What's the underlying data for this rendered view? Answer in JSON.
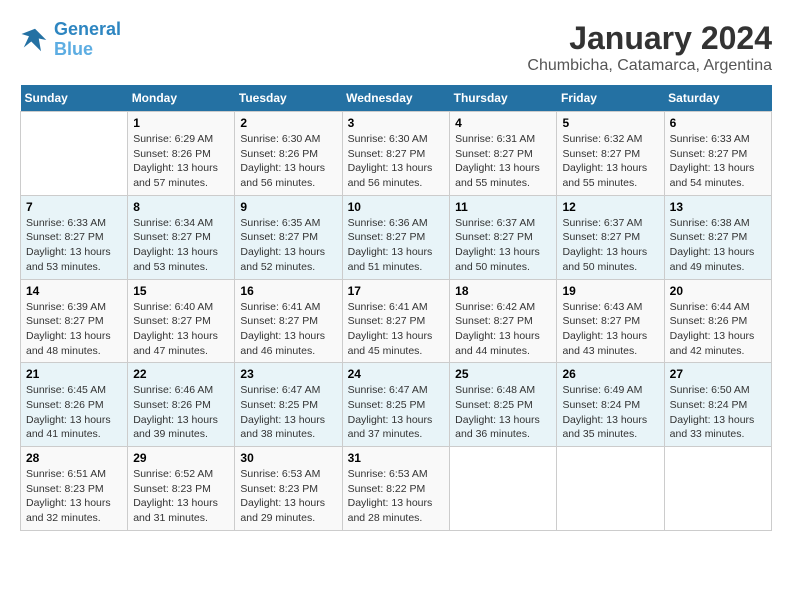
{
  "logo": {
    "line1": "General",
    "line2": "Blue"
  },
  "title": "January 2024",
  "subtitle": "Chumbicha, Catamarca, Argentina",
  "days_header": [
    "Sunday",
    "Monday",
    "Tuesday",
    "Wednesday",
    "Thursday",
    "Friday",
    "Saturday"
  ],
  "weeks": [
    [
      {
        "num": "",
        "sunrise": "",
        "sunset": "",
        "daylight": ""
      },
      {
        "num": "1",
        "sunrise": "Sunrise: 6:29 AM",
        "sunset": "Sunset: 8:26 PM",
        "daylight": "Daylight: 13 hours and 57 minutes."
      },
      {
        "num": "2",
        "sunrise": "Sunrise: 6:30 AM",
        "sunset": "Sunset: 8:26 PM",
        "daylight": "Daylight: 13 hours and 56 minutes."
      },
      {
        "num": "3",
        "sunrise": "Sunrise: 6:30 AM",
        "sunset": "Sunset: 8:27 PM",
        "daylight": "Daylight: 13 hours and 56 minutes."
      },
      {
        "num": "4",
        "sunrise": "Sunrise: 6:31 AM",
        "sunset": "Sunset: 8:27 PM",
        "daylight": "Daylight: 13 hours and 55 minutes."
      },
      {
        "num": "5",
        "sunrise": "Sunrise: 6:32 AM",
        "sunset": "Sunset: 8:27 PM",
        "daylight": "Daylight: 13 hours and 55 minutes."
      },
      {
        "num": "6",
        "sunrise": "Sunrise: 6:33 AM",
        "sunset": "Sunset: 8:27 PM",
        "daylight": "Daylight: 13 hours and 54 minutes."
      }
    ],
    [
      {
        "num": "7",
        "sunrise": "Sunrise: 6:33 AM",
        "sunset": "Sunset: 8:27 PM",
        "daylight": "Daylight: 13 hours and 53 minutes."
      },
      {
        "num": "8",
        "sunrise": "Sunrise: 6:34 AM",
        "sunset": "Sunset: 8:27 PM",
        "daylight": "Daylight: 13 hours and 53 minutes."
      },
      {
        "num": "9",
        "sunrise": "Sunrise: 6:35 AM",
        "sunset": "Sunset: 8:27 PM",
        "daylight": "Daylight: 13 hours and 52 minutes."
      },
      {
        "num": "10",
        "sunrise": "Sunrise: 6:36 AM",
        "sunset": "Sunset: 8:27 PM",
        "daylight": "Daylight: 13 hours and 51 minutes."
      },
      {
        "num": "11",
        "sunrise": "Sunrise: 6:37 AM",
        "sunset": "Sunset: 8:27 PM",
        "daylight": "Daylight: 13 hours and 50 minutes."
      },
      {
        "num": "12",
        "sunrise": "Sunrise: 6:37 AM",
        "sunset": "Sunset: 8:27 PM",
        "daylight": "Daylight: 13 hours and 50 minutes."
      },
      {
        "num": "13",
        "sunrise": "Sunrise: 6:38 AM",
        "sunset": "Sunset: 8:27 PM",
        "daylight": "Daylight: 13 hours and 49 minutes."
      }
    ],
    [
      {
        "num": "14",
        "sunrise": "Sunrise: 6:39 AM",
        "sunset": "Sunset: 8:27 PM",
        "daylight": "Daylight: 13 hours and 48 minutes."
      },
      {
        "num": "15",
        "sunrise": "Sunrise: 6:40 AM",
        "sunset": "Sunset: 8:27 PM",
        "daylight": "Daylight: 13 hours and 47 minutes."
      },
      {
        "num": "16",
        "sunrise": "Sunrise: 6:41 AM",
        "sunset": "Sunset: 8:27 PM",
        "daylight": "Daylight: 13 hours and 46 minutes."
      },
      {
        "num": "17",
        "sunrise": "Sunrise: 6:41 AM",
        "sunset": "Sunset: 8:27 PM",
        "daylight": "Daylight: 13 hours and 45 minutes."
      },
      {
        "num": "18",
        "sunrise": "Sunrise: 6:42 AM",
        "sunset": "Sunset: 8:27 PM",
        "daylight": "Daylight: 13 hours and 44 minutes."
      },
      {
        "num": "19",
        "sunrise": "Sunrise: 6:43 AM",
        "sunset": "Sunset: 8:27 PM",
        "daylight": "Daylight: 13 hours and 43 minutes."
      },
      {
        "num": "20",
        "sunrise": "Sunrise: 6:44 AM",
        "sunset": "Sunset: 8:26 PM",
        "daylight": "Daylight: 13 hours and 42 minutes."
      }
    ],
    [
      {
        "num": "21",
        "sunrise": "Sunrise: 6:45 AM",
        "sunset": "Sunset: 8:26 PM",
        "daylight": "Daylight: 13 hours and 41 minutes."
      },
      {
        "num": "22",
        "sunrise": "Sunrise: 6:46 AM",
        "sunset": "Sunset: 8:26 PM",
        "daylight": "Daylight: 13 hours and 39 minutes."
      },
      {
        "num": "23",
        "sunrise": "Sunrise: 6:47 AM",
        "sunset": "Sunset: 8:25 PM",
        "daylight": "Daylight: 13 hours and 38 minutes."
      },
      {
        "num": "24",
        "sunrise": "Sunrise: 6:47 AM",
        "sunset": "Sunset: 8:25 PM",
        "daylight": "Daylight: 13 hours and 37 minutes."
      },
      {
        "num": "25",
        "sunrise": "Sunrise: 6:48 AM",
        "sunset": "Sunset: 8:25 PM",
        "daylight": "Daylight: 13 hours and 36 minutes."
      },
      {
        "num": "26",
        "sunrise": "Sunrise: 6:49 AM",
        "sunset": "Sunset: 8:24 PM",
        "daylight": "Daylight: 13 hours and 35 minutes."
      },
      {
        "num": "27",
        "sunrise": "Sunrise: 6:50 AM",
        "sunset": "Sunset: 8:24 PM",
        "daylight": "Daylight: 13 hours and 33 minutes."
      }
    ],
    [
      {
        "num": "28",
        "sunrise": "Sunrise: 6:51 AM",
        "sunset": "Sunset: 8:23 PM",
        "daylight": "Daylight: 13 hours and 32 minutes."
      },
      {
        "num": "29",
        "sunrise": "Sunrise: 6:52 AM",
        "sunset": "Sunset: 8:23 PM",
        "daylight": "Daylight: 13 hours and 31 minutes."
      },
      {
        "num": "30",
        "sunrise": "Sunrise: 6:53 AM",
        "sunset": "Sunset: 8:23 PM",
        "daylight": "Daylight: 13 hours and 29 minutes."
      },
      {
        "num": "31",
        "sunrise": "Sunrise: 6:53 AM",
        "sunset": "Sunset: 8:22 PM",
        "daylight": "Daylight: 13 hours and 28 minutes."
      },
      {
        "num": "",
        "sunrise": "",
        "sunset": "",
        "daylight": ""
      },
      {
        "num": "",
        "sunrise": "",
        "sunset": "",
        "daylight": ""
      },
      {
        "num": "",
        "sunrise": "",
        "sunset": "",
        "daylight": ""
      }
    ]
  ]
}
